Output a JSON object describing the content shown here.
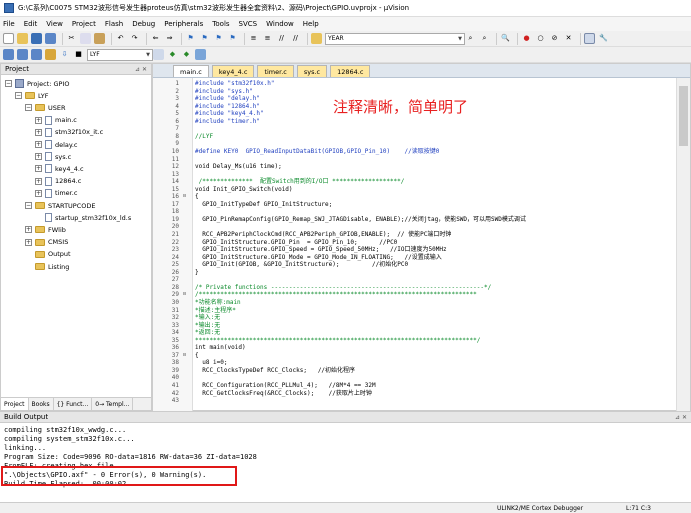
{
  "window": {
    "title": "G:\\C系列\\C0075 STM32波形信号发生器proteus仿真\\stm32波形发生器全套资料\\2、源码\\Project\\GPIO.uvprojx - µVision"
  },
  "menu": [
    "File",
    "Edit",
    "View",
    "Project",
    "Flash",
    "Debug",
    "Peripherals",
    "Tools",
    "SVCS",
    "Window",
    "Help"
  ],
  "toolbar": {
    "find_combo": "YEAR",
    "target_combo": "LYF"
  },
  "project_panel": {
    "title": "Project",
    "tree": [
      {
        "label": "Project: GPIO",
        "kind": "root",
        "level": 0,
        "expander": "−"
      },
      {
        "label": "LYF",
        "kind": "folder",
        "level": 1,
        "expander": "−"
      },
      {
        "label": "USER",
        "kind": "folder",
        "level": 2,
        "expander": "−"
      },
      {
        "label": "main.c",
        "kind": "file",
        "level": 3,
        "expander": "+"
      },
      {
        "label": "stm32f10x_it.c",
        "kind": "file",
        "level": 3,
        "expander": "+"
      },
      {
        "label": "delay.c",
        "kind": "file",
        "level": 3,
        "expander": "+"
      },
      {
        "label": "sys.c",
        "kind": "file",
        "level": 3,
        "expander": "+"
      },
      {
        "label": "key4_4.c",
        "kind": "file",
        "level": 3,
        "expander": "+"
      },
      {
        "label": "12864.c",
        "kind": "file",
        "level": 3,
        "expander": "+"
      },
      {
        "label": "timer.c",
        "kind": "file",
        "level": 3,
        "expander": "+"
      },
      {
        "label": "STARTUPCODE",
        "kind": "folder",
        "level": 2,
        "expander": "−"
      },
      {
        "label": "startup_stm32f10x_ld.s",
        "kind": "file",
        "level": 3,
        "expander": ""
      },
      {
        "label": "FWlib",
        "kind": "folder",
        "level": 2,
        "expander": "+"
      },
      {
        "label": "CMSIS",
        "kind": "folder",
        "level": 2,
        "expander": "+"
      },
      {
        "label": "Output",
        "kind": "folder",
        "level": 2,
        "expander": ""
      },
      {
        "label": "Listing",
        "kind": "folder",
        "level": 2,
        "expander": ""
      }
    ],
    "bottom_tabs": [
      "Project",
      "Books",
      "{} Funct...",
      "0→ Templ..."
    ]
  },
  "editor": {
    "tabs": [
      "main.c",
      "key4_4.c",
      "timer.c",
      "sys.c",
      "12864.c"
    ],
    "active_tab": 0,
    "annotation": "注释清晰，简单明了",
    "lines": [
      {
        "n": "1",
        "f": "",
        "t": "#include \"stm32f10x.h\"",
        "c": "pre"
      },
      {
        "n": "2",
        "f": "",
        "t": "#include \"sys.h\"",
        "c": "pre"
      },
      {
        "n": "3",
        "f": "",
        "t": "#include \"delay.h\"",
        "c": "pre"
      },
      {
        "n": "4",
        "f": "",
        "t": "#include \"12864.h\"",
        "c": "pre"
      },
      {
        "n": "5",
        "f": "",
        "t": "#include \"key4_4.h\"",
        "c": "pre"
      },
      {
        "n": "6",
        "f": "",
        "t": "#include \"timer.h\"",
        "c": "pre"
      },
      {
        "n": "7",
        "f": "",
        "t": "",
        "c": ""
      },
      {
        "n": "8",
        "f": "",
        "t": "//LYF",
        "c": "cm"
      },
      {
        "n": "9",
        "f": "",
        "t": "",
        "c": ""
      },
      {
        "n": "10",
        "f": "",
        "t": "#define KEY0  GPIO_ReadInputDataBit(GPIOB,GPIO_Pin_10)    //读取按键0",
        "c": "pre"
      },
      {
        "n": "11",
        "f": "",
        "t": "",
        "c": ""
      },
      {
        "n": "12",
        "f": "",
        "t": "void Delay_Ms(u16 time);",
        "c": ""
      },
      {
        "n": "13",
        "f": "",
        "t": "",
        "c": ""
      },
      {
        "n": "14",
        "f": "",
        "t": " /**************  配置Switch用到的I/O口 *******************/",
        "c": "cm"
      },
      {
        "n": "15",
        "f": "",
        "t": "void Init_GPIO_Switch(void)",
        "c": ""
      },
      {
        "n": "16",
        "f": "⊟",
        "t": "{",
        "c": ""
      },
      {
        "n": "17",
        "f": "",
        "t": "  GPIO_InitTypeDef GPIO_InitStructure;",
        "c": ""
      },
      {
        "n": "18",
        "f": "",
        "t": "",
        "c": ""
      },
      {
        "n": "19",
        "f": "",
        "t": "  GPIO_PinRemapConfig(GPIO_Remap_SWJ_JTAGDisable, ENABLE);//关闭jtag，使能SWD，可以用SWD模式调试",
        "c": ""
      },
      {
        "n": "20",
        "f": "",
        "t": "",
        "c": ""
      },
      {
        "n": "21",
        "f": "",
        "t": "  RCC_APB2PeriphClockCmd(RCC_APB2Periph_GPIOB,ENABLE);  // 使能PC端口时钟",
        "c": ""
      },
      {
        "n": "22",
        "f": "",
        "t": "  GPIO_InitStructure.GPIO_Pin  = GPIO_Pin_10;      //PC0",
        "c": ""
      },
      {
        "n": "23",
        "f": "",
        "t": "  GPIO_InitStructure.GPIO_Speed = GPIO_Speed_50MHz;   //IO口速度为50MHz",
        "c": ""
      },
      {
        "n": "24",
        "f": "",
        "t": "  GPIO_InitStructure.GPIO_Mode = GPIO_Mode_IN_FLOATING;   //设置成输入",
        "c": ""
      },
      {
        "n": "25",
        "f": "",
        "t": "  GPIO_Init(GPIOB, &GPIO_InitStructure);         //初始化PC0",
        "c": ""
      },
      {
        "n": "26",
        "f": "",
        "t": "}",
        "c": ""
      },
      {
        "n": "27",
        "f": "",
        "t": "",
        "c": ""
      },
      {
        "n": "28",
        "f": "",
        "t": "/* Private functions -----------------------------------------------------------*/",
        "c": "cm"
      },
      {
        "n": "29",
        "f": "⊟",
        "t": "/*****************************************************************************",
        "c": "cm"
      },
      {
        "n": "30",
        "f": "",
        "t": "*功能名称:main",
        "c": "cm"
      },
      {
        "n": "31",
        "f": "",
        "t": "*描述:主程序*",
        "c": "cm"
      },
      {
        "n": "32",
        "f": "",
        "t": "*输入:无",
        "c": "cm"
      },
      {
        "n": "33",
        "f": "",
        "t": "*输出:无",
        "c": "cm"
      },
      {
        "n": "34",
        "f": "",
        "t": "*返回:无",
        "c": "cm"
      },
      {
        "n": "35",
        "f": "",
        "t": "******************************************************************************/",
        "c": "cm"
      },
      {
        "n": "36",
        "f": "",
        "t": "int main(void)",
        "c": ""
      },
      {
        "n": "37",
        "f": "⊟",
        "t": "{",
        "c": ""
      },
      {
        "n": "38",
        "f": "",
        "t": "  u8 i=0;",
        "c": ""
      },
      {
        "n": "39",
        "f": "",
        "t": "  RCC_ClocksTypeDef RCC_Clocks;   //初始化程序",
        "c": ""
      },
      {
        "n": "40",
        "f": "",
        "t": "",
        "c": ""
      },
      {
        "n": "41",
        "f": "",
        "t": "  RCC_Configuration(RCC_PLLMul_4);   //8M*4 == 32M",
        "c": ""
      },
      {
        "n": "42",
        "f": "",
        "t": "  RCC_GetClocksFreq(&RCC_Clocks);    //获取片上时钟",
        "c": ""
      },
      {
        "n": "43",
        "f": "",
        "t": "",
        "c": ""
      }
    ]
  },
  "build_output": {
    "title": "Build Output",
    "lines": [
      "compiling stm32f10x_wwdg.c...",
      "compiling system_stm32f10x.c...",
      "linking...",
      "Program Size: Code=9096 RO-data=1816 RW-data=36 ZI-data=1028",
      "FromELF: creating hex file...",
      "\".\\Objects\\GPIO.axf\" - 0 Error(s), 0 Warning(s).",
      "Build Time Elapsed:  00:00:02"
    ]
  },
  "status": {
    "debugger": "ULINK2/ME Cortex Debugger",
    "position": "L:71 C:3"
  }
}
